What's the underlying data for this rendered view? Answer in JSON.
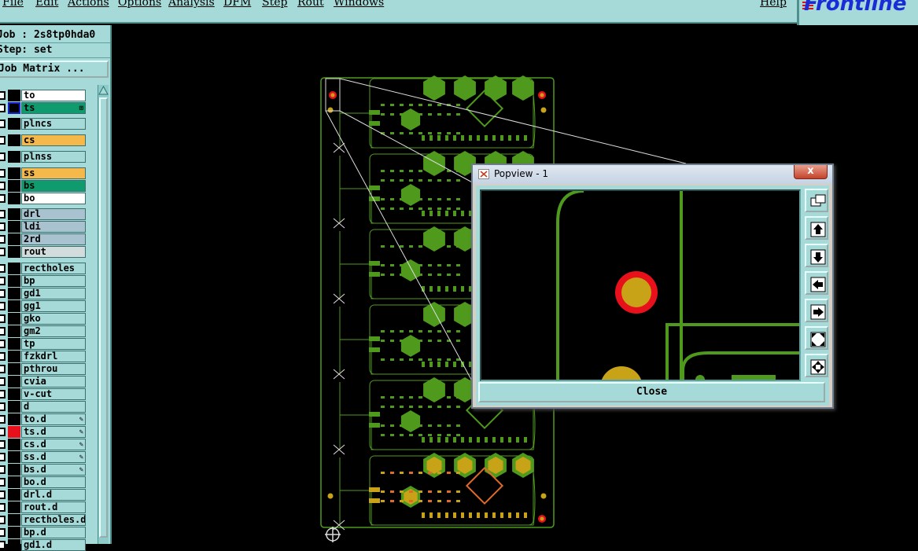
{
  "menu": {
    "items": [
      {
        "id": "file",
        "label": "File"
      },
      {
        "id": "edit",
        "label": "Edit"
      },
      {
        "id": "actions",
        "label": "Actions"
      },
      {
        "id": "options",
        "label": "Options"
      },
      {
        "id": "analysis",
        "label": "Analysis"
      },
      {
        "id": "dfm",
        "label": "DFM"
      },
      {
        "id": "step",
        "label": "Step"
      },
      {
        "id": "rout",
        "label": "Rout"
      },
      {
        "id": "windows",
        "label": "Windows"
      }
    ],
    "help_label": "Help"
  },
  "logo": {
    "text": "Frontline",
    "color": "#1a2bd8"
  },
  "job": {
    "job_line": "Job : 2s8tp0hda0",
    "step_line": "Step: set",
    "matrix_button": "Job Matrix ..."
  },
  "layers": [
    {
      "name": "to",
      "color": "#ffffff",
      "mark": ""
    },
    {
      "name": "ts",
      "color": "#0f9b6e",
      "mark": "⊞",
      "selected": true
    },
    {
      "name": "plncs",
      "color": "#a6dad8",
      "mark": ""
    },
    {
      "name": "cs",
      "color": "#f5b84b",
      "mark": ""
    },
    {
      "name": "plnss",
      "color": "#a6dad8",
      "mark": ""
    },
    {
      "name": "ss",
      "color": "#f5b84b",
      "mark": ""
    },
    {
      "name": "bs",
      "color": "#0f9b6e",
      "mark": ""
    },
    {
      "name": "bo",
      "color": "#ffffff",
      "mark": ""
    },
    {
      "name": "drl",
      "color": "#a9c2cf",
      "mark": ""
    },
    {
      "name": "ldi",
      "color": "#a9c2cf",
      "mark": ""
    },
    {
      "name": "2rd",
      "color": "#a9c2cf",
      "mark": ""
    },
    {
      "name": "rout",
      "color": "#d3dcdc",
      "mark": ""
    },
    {
      "name": "rectholes",
      "color": "#a6dad8",
      "mark": ""
    },
    {
      "name": "bp",
      "color": "#a6dad8",
      "mark": ""
    },
    {
      "name": "gd1",
      "color": "#a6dad8",
      "mark": ""
    },
    {
      "name": "gg1",
      "color": "#a6dad8",
      "mark": ""
    },
    {
      "name": "gko",
      "color": "#a6dad8",
      "mark": ""
    },
    {
      "name": "gm2",
      "color": "#a6dad8",
      "mark": ""
    },
    {
      "name": "tp",
      "color": "#a6dad8",
      "mark": ""
    },
    {
      "name": "fzkdrl",
      "color": "#a6dad8",
      "mark": ""
    },
    {
      "name": "pthrou",
      "color": "#a6dad8",
      "mark": ""
    },
    {
      "name": "cvia",
      "color": "#a6dad8",
      "mark": ""
    },
    {
      "name": "v-cut",
      "color": "#a6dad8",
      "mark": ""
    },
    {
      "name": "d",
      "color": "#a6dad8",
      "mark": ""
    },
    {
      "name": "to.d",
      "color": "#a6dad8",
      "mark": "✎"
    },
    {
      "name": "ts.d",
      "color": "#a6dad8",
      "mark": "✎",
      "swatch": "#e8101a"
    },
    {
      "name": "cs.d",
      "color": "#a6dad8",
      "mark": "✎"
    },
    {
      "name": "ss.d",
      "color": "#a6dad8",
      "mark": "✎"
    },
    {
      "name": "bs.d",
      "color": "#a6dad8",
      "mark": "✎"
    },
    {
      "name": "bo.d",
      "color": "#a6dad8",
      "mark": ""
    },
    {
      "name": "drl.d",
      "color": "#a6dad8",
      "mark": ""
    },
    {
      "name": "rout.d",
      "color": "#a6dad8",
      "mark": ""
    },
    {
      "name": "rectholes.d",
      "color": "#a6dad8",
      "mark": ""
    },
    {
      "name": "bp.d",
      "color": "#a6dad8",
      "mark": ""
    },
    {
      "name": "gd1.d",
      "color": "#a6dad8",
      "mark": ""
    }
  ],
  "popview": {
    "title": "Popview - 1",
    "close_x": "x",
    "close_button": "Close",
    "tools": [
      "zoom-fit-icon",
      "pan-up-icon",
      "pan-down-icon",
      "pan-left-icon",
      "pan-right-icon",
      "zoom-in-icon",
      "zoom-out-icon"
    ]
  },
  "colors": {
    "panel": "#a6dad8",
    "trace": "#4f9a1c",
    "pad_green": "#4f9a1c",
    "pad_gold": "#c8a317",
    "pad_red": "#e8101a"
  }
}
